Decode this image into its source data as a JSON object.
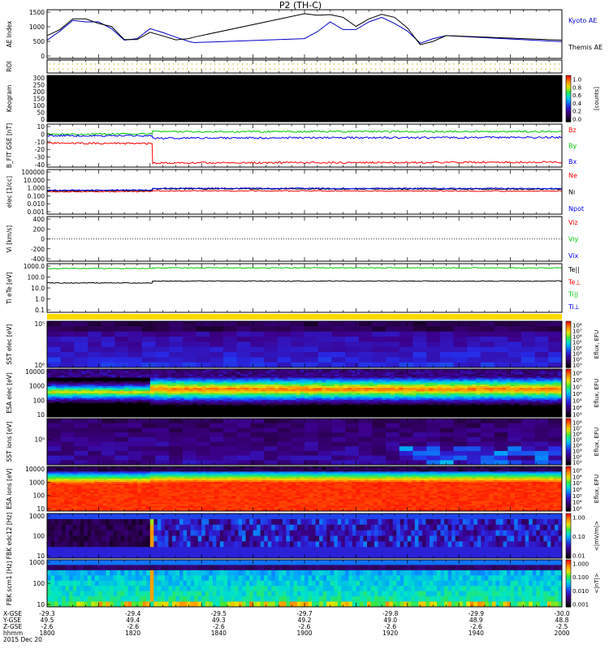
{
  "title": "P2 (TH-C)",
  "footer": {
    "row_labels": [
      "X-GSE",
      "Y-GSE",
      "Z-GSE",
      "hhmm",
      "2015 Dec 20"
    ],
    "columns": [
      [
        "-29.3",
        "49.5",
        "-2.6",
        "1800"
      ],
      [
        "-29.4",
        "49.4",
        "-2.6",
        "1820"
      ],
      [
        "-29.5",
        "49.3",
        "-2.6",
        "1840"
      ],
      [
        "-29.7",
        "49.2",
        "-2.6",
        "1900"
      ],
      [
        "-29.8",
        "49.0",
        "-2.6",
        "1920"
      ],
      [
        "-29.9",
        "48.9",
        "-2.6",
        "1940"
      ],
      [
        "-30.0",
        "48.8",
        "-2.5",
        "2000"
      ]
    ]
  },
  "colors": {
    "kyoto": "#0000c8",
    "themis": "#000000",
    "red": "#ff0000",
    "green": "#00c800",
    "blue": "#0000ff",
    "roi_dot": "#c8b400",
    "yellow": "#ffd800"
  },
  "chart_data": [
    {
      "panel": "ae",
      "type": "line",
      "ylabel": "AE Index",
      "ylim": [
        0,
        1600
      ],
      "yticks": [
        "1500",
        "1000",
        "500",
        "0"
      ],
      "x": [
        1800,
        1805,
        1810,
        1815,
        1820,
        1825,
        1830,
        1835,
        1840,
        1845,
        1850,
        1855,
        1857,
        1900,
        1905,
        1910,
        1915,
        1920,
        1925,
        1930,
        1935,
        1940,
        1945,
        1950,
        1955,
        2000
      ],
      "series": [
        {
          "name": "Kyoto AE",
          "color": "#0000c8",
          "values": [
            600,
            900,
            1250,
            1200,
            1200,
            980,
            600,
            650,
            980,
            850,
            700,
            560,
            520,
            650,
            880,
            1200,
            950,
            950,
            1200,
            1350,
            1150,
            900,
            500,
            650,
            750,
            550
          ]
        },
        {
          "name": "Themis AE",
          "color": "#000000",
          "values": [
            750,
            950,
            1300,
            1300,
            1150,
            1050,
            620,
            620,
            860,
            740,
            610,
            650,
            700,
            1470,
            1420,
            1440,
            1350,
            1050,
            1300,
            1450,
            1350,
            1000,
            450,
            560,
            750,
            600
          ]
        }
      ]
    },
    {
      "panel": "roi",
      "type": "line",
      "ylabel": "ROI"
    },
    {
      "panel": "keogram",
      "type": "heatmap",
      "ylabel": "Keogram",
      "ylim": [
        0,
        300
      ],
      "yticks": [
        "300",
        "250",
        "200",
        "150",
        "100",
        "50",
        "0"
      ],
      "colorbar": {
        "label": "[counts]",
        "ticks": [
          "1.0",
          "0.8",
          "0.6",
          "0.4",
          "0.2",
          "0.0"
        ]
      }
    },
    {
      "panel": "bfit",
      "type": "line",
      "ylabel": "B_FIT GSE [nT]",
      "ylim": [
        -42,
        10
      ],
      "yticks": [
        "10",
        "0",
        "-10",
        "-20",
        "-30",
        "-40"
      ],
      "x": [
        1800,
        1840.8,
        1841,
        2000
      ],
      "series": [
        {
          "name": "Bz",
          "color": "#ff0000",
          "values": [
            -13,
            -13.5,
            -37,
            -36
          ]
        },
        {
          "name": "By",
          "color": "#00c800",
          "values": [
            -2,
            -2,
            1,
            1
          ]
        },
        {
          "name": "Bx",
          "color": "#0000ff",
          "values": [
            -4,
            -4,
            -7,
            -6
          ]
        }
      ]
    },
    {
      "panel": "density",
      "type": "line",
      "ylabel": "elec [1/cc]",
      "log": true,
      "ylim": [
        0.001,
        100000
      ],
      "yticks": [
        "100000",
        "10.000",
        "1.000",
        "0.100",
        "0.010",
        "0.001"
      ],
      "x": [
        1800,
        1840.8,
        1841,
        2000
      ],
      "series": [
        {
          "name": "Ne",
          "color": "#ff0000",
          "values": [
            10,
            12,
            15,
            14
          ]
        },
        {
          "name": "Ni",
          "color": "#000000",
          "values": [
            15,
            18,
            35,
            30
          ]
        },
        {
          "name": "Npot",
          "color": "#0000ff",
          "values": [
            20,
            22,
            45,
            40
          ]
        }
      ]
    },
    {
      "panel": "velocity",
      "type": "line",
      "ylabel": "Vi [km/s]",
      "ylim": [
        -500,
        500
      ],
      "yticks": [
        "400",
        "200",
        "0",
        "-200",
        "-400"
      ],
      "series": [
        {
          "name": "Viz",
          "color": "#ff0000"
        },
        {
          "name": "Viy",
          "color": "#00c800"
        },
        {
          "name": "Vix",
          "color": "#0000ff"
        }
      ]
    },
    {
      "panel": "temperature",
      "type": "line",
      "ylabel": "Ti eTe [eV]",
      "log": true,
      "ylim": [
        0.05,
        2000
      ],
      "yticks": [
        "1000.0",
        "100.0",
        "10.0",
        "1.0",
        "0.1"
      ],
      "x": [
        1800,
        1840.8,
        1841,
        2000
      ],
      "series": [
        {
          "name": "Te||",
          "color": "#000000",
          "values": [
            30,
            30,
            45,
            45
          ]
        },
        {
          "name": "Te⊥",
          "color": "#ff0000",
          "values": [
            null,
            null,
            null,
            null
          ]
        },
        {
          "name": "Ti||",
          "color": "#00c800",
          "values": [
            700,
            700,
            800,
            800
          ]
        },
        {
          "name": "Ti⊥",
          "color": "#0000ff",
          "values": [
            null,
            null,
            null,
            null
          ]
        }
      ]
    },
    {
      "panel": "sst_e",
      "type": "heatmap",
      "ylabel": "SST elec [eV]",
      "yticks": [
        "10⁵",
        "10⁶"
      ],
      "colorbar": {
        "label": "Eflux, EFU",
        "ticks": [
          "10⁸",
          "10⁷",
          "10⁶",
          "10⁵",
          "10⁴",
          "10³",
          "10²",
          "10¹"
        ]
      }
    },
    {
      "panel": "esa_e",
      "type": "heatmap",
      "ylabel": "ESA elec [eV]",
      "yticks": [
        "10000",
        "1000",
        "100",
        "10"
      ],
      "colorbar": {
        "label": "Eflux, EFU",
        "ticks": [
          "10⁹",
          "10⁸",
          "10⁷",
          "10⁶",
          "10⁵",
          "10⁴",
          "10³"
        ]
      }
    },
    {
      "panel": "sst_i",
      "type": "heatmap",
      "ylabel": "SST ions [eV]",
      "yticks": [
        "10⁵"
      ],
      "colorbar": {
        "label": "Eflux, EFU",
        "ticks": [
          "10⁸",
          "10⁷",
          "10⁶",
          "10⁵",
          "10⁴",
          "10³",
          "10²",
          "10¹"
        ]
      }
    },
    {
      "panel": "esa_i",
      "type": "heatmap",
      "ylabel": "ESA ions [eV]",
      "yticks": [
        "10000",
        "1000",
        "100",
        "10"
      ],
      "colorbar": {
        "label": "Eflux, EFU",
        "ticks": [
          "10⁹",
          "10⁸",
          "10⁷",
          "10⁶",
          "10⁵",
          "10⁴",
          "10³"
        ]
      }
    },
    {
      "panel": "fbk_e",
      "type": "heatmap",
      "ylabel": "FBK edc12 [Hz]",
      "yticks": [
        "1000",
        "100",
        "10"
      ],
      "colorbar": {
        "label": "<|mV/m|>",
        "ticks": [
          "1.00",
          "0.10",
          "0.01"
        ]
      }
    },
    {
      "panel": "fbk_b",
      "type": "heatmap",
      "ylabel": "FBK scm1 [Hz]",
      "yticks": [
        "1000",
        "100",
        "10"
      ],
      "colorbar": {
        "label": "<|nT|>",
        "ticks": [
          "1.000",
          "0.100",
          "0.010",
          "0.001"
        ]
      }
    }
  ]
}
